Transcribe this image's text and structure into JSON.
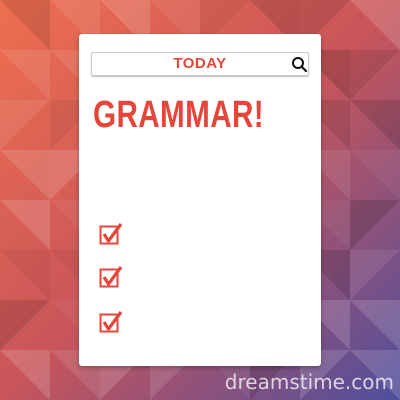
{
  "colors": {
    "accent": "#e8453a",
    "card": "#ffffff",
    "bg_top_left": "#eb6a4c",
    "bg_bottom_right": "#4f4f9a"
  },
  "search": {
    "text": "TODAY",
    "icon": "search-icon"
  },
  "heading": "GRAMMAR!",
  "checklist": [
    {
      "icon": "checkbox-checked-icon",
      "checked": true
    },
    {
      "icon": "checkbox-checked-icon",
      "checked": true
    },
    {
      "icon": "checkbox-checked-icon",
      "checked": true
    }
  ],
  "watermark": "dreamstime.com"
}
